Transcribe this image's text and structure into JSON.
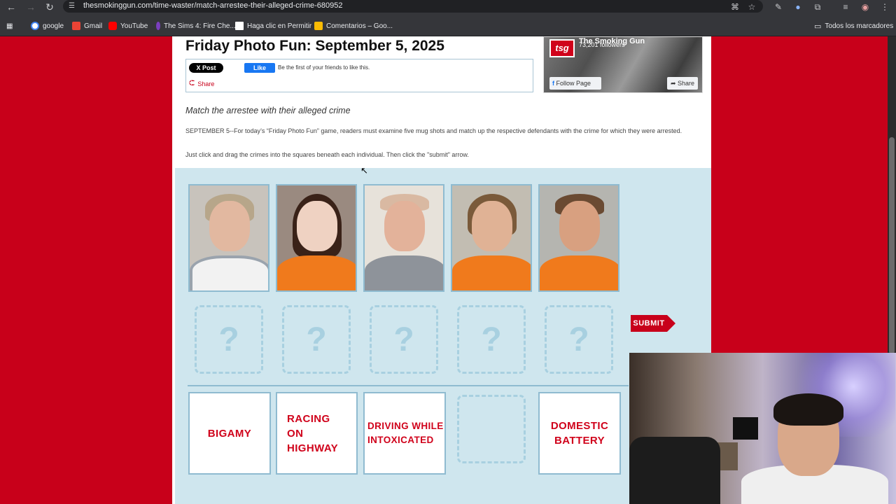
{
  "browser": {
    "url": "thesmokinggun.com/time-waster/match-arrestee-their-alleged-crime-680952",
    "bookmarks": [
      "google",
      "Gmail",
      "YouTube",
      "The Sims 4: Fire Che...",
      "Haga clic en Permitir",
      "Comentarios – Goo..."
    ],
    "all_bookmarks": "Todos los marcadores"
  },
  "article": {
    "title": "Friday Photo Fun: September 5, 2025",
    "x_post": "X Post",
    "fb_like": "Like",
    "fb_like_text": "Be the first of your friends to like this.",
    "share": "Share",
    "subtitle": "Match the arrestee with their alleged crime",
    "paragraph1": "SEPTEMBER 5--For today’s “Friday Photo Fun” game, readers must examine five mug shots and match up the respective defendants with the crime for which they were arrested.",
    "paragraph2": "Just click and drag the crimes into the squares beneath each individual. Then click the \"submit\" arrow."
  },
  "fb_widget": {
    "logo": "tsg",
    "page_name": "The Smoking Gun",
    "followers": "73,201 followers",
    "follow_btn": "Follow Page",
    "share_btn": "Share"
  },
  "game": {
    "dropzone_symbol": "?",
    "submit": "SUBMIT",
    "crimes": [
      "BIGAMY",
      "RACING ON HIGHWAY",
      "DRIVING WHILE INTOXICATED",
      "",
      "DOMESTIC BATTERY"
    ]
  },
  "colors": {
    "brand_red": "#c8001a",
    "game_bg": "#cfe6ee",
    "crime_text": "#d0021b"
  }
}
